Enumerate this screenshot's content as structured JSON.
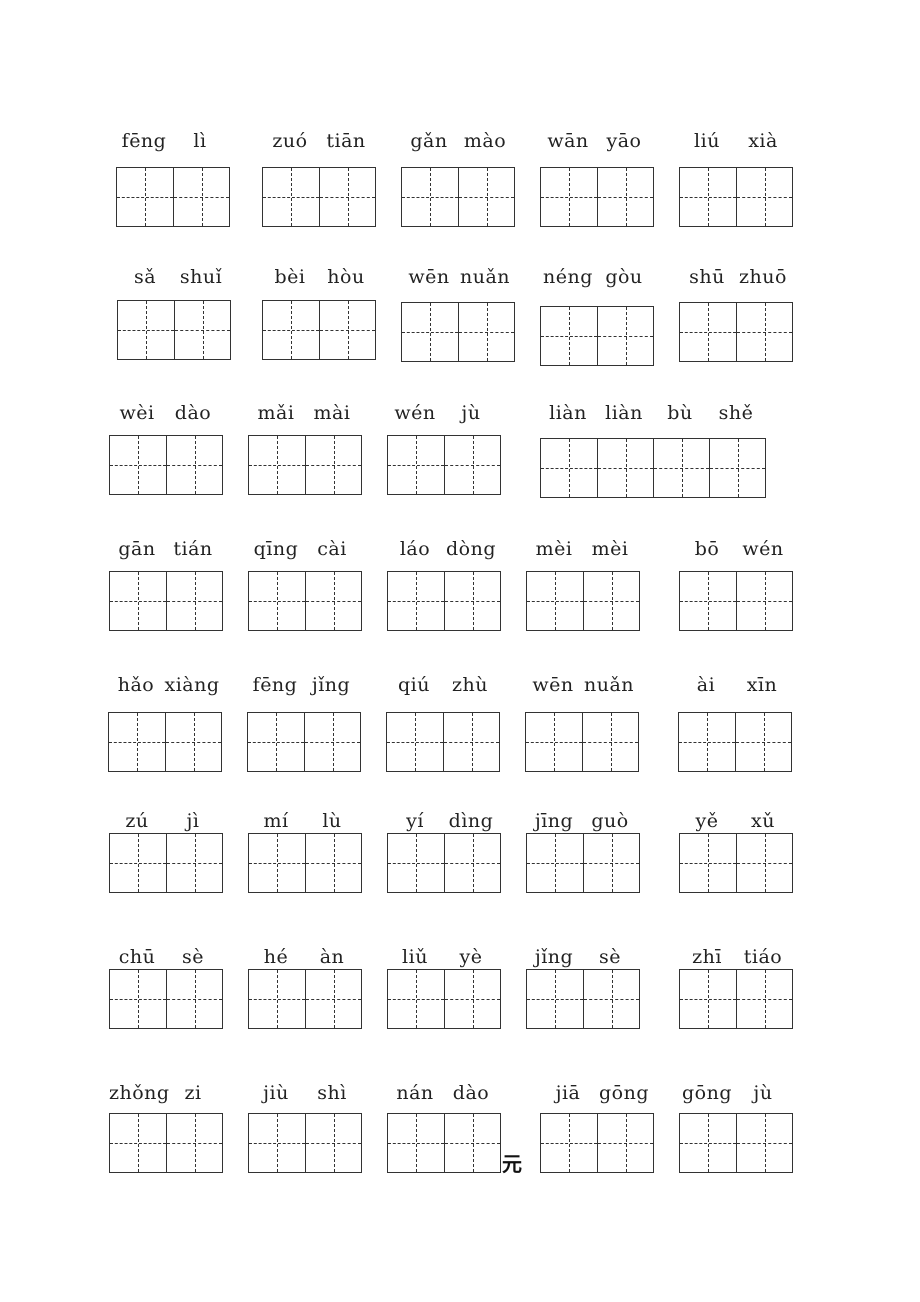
{
  "worksheet": {
    "rows": [
      [
        {
          "syllables": [
            "fēng",
            "lì"
          ]
        },
        {
          "syllables": [
            "zuó",
            "tiān"
          ]
        },
        {
          "syllables": [
            "gǎn",
            "mào"
          ]
        },
        {
          "syllables": [
            "wān",
            "yāo"
          ]
        },
        {
          "syllables": [
            "liú",
            "xià"
          ]
        }
      ],
      [
        {
          "syllables": [
            "sǎ",
            "shuǐ"
          ]
        },
        {
          "syllables": [
            "bèi",
            "hòu"
          ]
        },
        {
          "syllables": [
            "wēn",
            "nuǎn"
          ]
        },
        {
          "syllables": [
            "néng",
            "gòu"
          ]
        },
        {
          "syllables": [
            "shū",
            "zhuō"
          ]
        }
      ],
      [
        {
          "syllables": [
            "wèi",
            "dào"
          ]
        },
        {
          "syllables": [
            "mǎi",
            "mài"
          ]
        },
        {
          "syllables": [
            "wén",
            "jù"
          ]
        },
        {
          "syllables": [
            "liàn",
            "liàn",
            "bù",
            "shě"
          ]
        }
      ],
      [
        {
          "syllables": [
            "gān",
            "tián"
          ]
        },
        {
          "syllables": [
            "qīng",
            "cài"
          ]
        },
        {
          "syllables": [
            "láo",
            "dòng"
          ]
        },
        {
          "syllables": [
            "mèi",
            "mèi"
          ]
        },
        {
          "syllables": [
            "bō",
            "wén"
          ]
        }
      ],
      [
        {
          "syllables": [
            "hǎo",
            "xiàng"
          ]
        },
        {
          "syllables": [
            "fēng",
            "jǐng"
          ]
        },
        {
          "syllables": [
            "qiú",
            "zhù"
          ]
        },
        {
          "syllables": [
            "wēn",
            "nuǎn"
          ]
        },
        {
          "syllables": [
            "ài",
            "xīn"
          ]
        }
      ],
      [
        {
          "syllables": [
            "zú",
            "jì"
          ]
        },
        {
          "syllables": [
            "mí",
            "lù"
          ]
        },
        {
          "syllables": [
            "yí",
            "dìng"
          ]
        },
        {
          "syllables": [
            "jīng",
            "guò"
          ]
        },
        {
          "syllables": [
            "yě",
            "xǔ"
          ]
        }
      ],
      [
        {
          "syllables": [
            "chū",
            "sè"
          ]
        },
        {
          "syllables": [
            "hé",
            "àn"
          ]
        },
        {
          "syllables": [
            "liǔ",
            "yè"
          ]
        },
        {
          "syllables": [
            "jǐng",
            "sè"
          ]
        },
        {
          "syllables": [
            "zhī",
            "tiáo"
          ]
        }
      ],
      [
        {
          "syllables": [
            "zhǒng",
            "zi"
          ]
        },
        {
          "syllables": [
            "jiù",
            "shì"
          ]
        },
        {
          "syllables": [
            "nán",
            "dào"
          ]
        },
        {
          "syllables": [
            "jiā",
            "gōng"
          ]
        },
        {
          "syllables": [
            "gōng",
            "jù"
          ]
        }
      ]
    ],
    "stray_character": "元"
  }
}
